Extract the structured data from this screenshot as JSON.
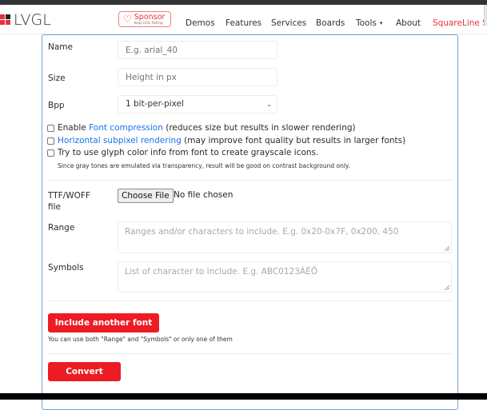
{
  "nav": {
    "logo_text": "LVGL",
    "sponsor": {
      "title": "Sponsor",
      "subtitle": "Keep LVGL Rolling"
    },
    "items": [
      {
        "label": "Demos"
      },
      {
        "label": "Features"
      },
      {
        "label": "Services"
      },
      {
        "label": "Boards"
      },
      {
        "label": "Tools",
        "has_dropdown": true
      },
      {
        "label": "About"
      },
      {
        "label": "SquareLine St",
        "highlight": true
      }
    ],
    "caret": "▾"
  },
  "form": {
    "name": {
      "label": "Name",
      "value": "",
      "placeholder": "E.g. arial_40"
    },
    "size": {
      "label": "Size",
      "value": "",
      "placeholder": "Height in px"
    },
    "bpp": {
      "label": "Bpp",
      "selected": "1 bit-per-pixel"
    },
    "options": [
      {
        "checked": false,
        "prefix": "Enable ",
        "link": "Font compression",
        "suffix": " (reduces size but results in slower rendering)"
      },
      {
        "checked": false,
        "prefix": "",
        "link": "Horizontal subpixel rendering",
        "suffix": " (may improve font quality but results in larger fonts)"
      },
      {
        "checked": false,
        "prefix": "Try to use glyph color info from font to create grayscale icons.",
        "link": "",
        "suffix": ""
      }
    ],
    "grayscale_note": "Since gray tones are emulated via transparency, result will be good on contrast background only.",
    "file": {
      "label_line1": "TTF/WOFF",
      "label_line2": "file",
      "button": "Choose File",
      "status": "No file chosen"
    },
    "range": {
      "label": "Range",
      "value": "",
      "placeholder": "Ranges and/or characters to include. E.g. 0x20-0x7F, 0x200, 450"
    },
    "symbols": {
      "label": "Symbols",
      "value": "",
      "placeholder": "List of character to include. E.g. ABC0123ÁÉŐ"
    },
    "include_button": "Include another font",
    "hint": "You can use both \"Range\" and \"Symbols\" or only one of them",
    "convert_button": "Convert"
  },
  "colors": {
    "accent_red": "#ed1c24",
    "link_blue": "#1a73e8",
    "card_border": "#6fa3d8"
  }
}
